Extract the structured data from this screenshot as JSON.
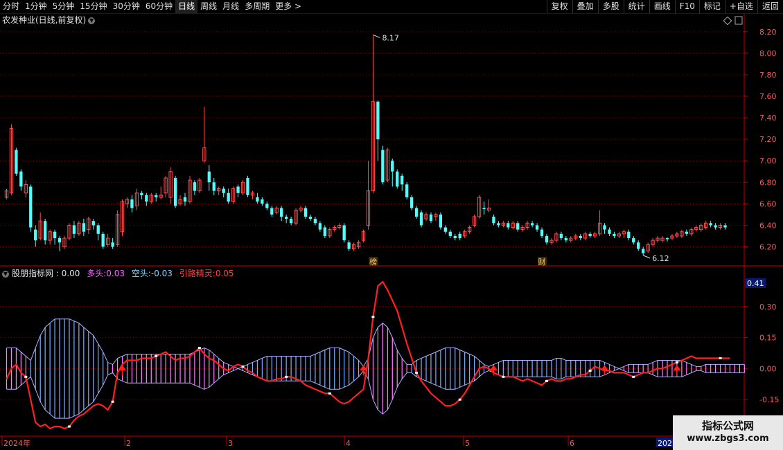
{
  "toolbar": {
    "periods": [
      "分时",
      "1分钟",
      "5分钟",
      "15分钟",
      "30分钟",
      "60分钟",
      "日线",
      "周线",
      "月线",
      "多周期",
      "更多 >"
    ],
    "active_period": "日线",
    "actions": [
      "复权",
      "叠加",
      "多股",
      "统计",
      "画线",
      "F10",
      "标记",
      "+自选",
      "返回"
    ]
  },
  "main_panel": {
    "title": "农发种业(日线,前复权)",
    "high_label": "8.17",
    "low_label": "6.12",
    "y_ticks": [
      "8.20",
      "8.00",
      "7.80",
      "7.60",
      "7.40",
      "7.20",
      "7.00",
      "6.80",
      "6.60",
      "6.40",
      "6.20"
    ],
    "markers": [
      "榜",
      "财"
    ]
  },
  "indicator_panel": {
    "name": "股朋指标网 : 0.00",
    "bull_label": "多头:",
    "bull_value": "0.03",
    "bear_label": "空头:",
    "bear_value": "-0.03",
    "guide_label": "引路精灵:",
    "guide_value": "0.05",
    "current_badge": "0.41",
    "y_ticks": [
      "0.30",
      "0.15",
      "0.00",
      "-0.15"
    ]
  },
  "x_axis": {
    "labels": [
      "2024年",
      "2",
      "3",
      "4",
      "5",
      "6"
    ],
    "current_label": "202"
  },
  "watermark": {
    "line1": "指标公式网",
    "line2": "www.zbgs3.com"
  },
  "colors": {
    "up": "#ff4b4b",
    "down": "#54fcfc",
    "bull_fill": "#ff80ff",
    "bear_fill": "#7fb0ff",
    "guide_line": "#ff2020",
    "grid": "#8b0000",
    "axis": "#c00000"
  },
  "chart_data": {
    "type": "candlestick",
    "title": "农发种业(日线,前复权)",
    "ylim": [
      6.1,
      8.25
    ],
    "highest": 8.17,
    "lowest": 6.12,
    "candles": [
      [
        6.66,
        6.72,
        6.64,
        6.74
      ],
      [
        6.7,
        7.3,
        6.68,
        7.34
      ],
      [
        7.1,
        6.88,
        6.86,
        7.12
      ],
      [
        6.9,
        6.76,
        6.72,
        6.92
      ],
      [
        6.7,
        6.78,
        6.66,
        6.82
      ],
      [
        6.76,
        6.38,
        6.34,
        6.78
      ],
      [
        6.36,
        6.26,
        6.2,
        6.4
      ],
      [
        6.28,
        6.44,
        6.26,
        6.52
      ],
      [
        6.44,
        6.26,
        6.22,
        6.46
      ],
      [
        6.26,
        6.34,
        6.22,
        6.36
      ],
      [
        6.34,
        6.28,
        6.22,
        6.36
      ],
      [
        6.28,
        6.24,
        6.16,
        6.3
      ],
      [
        6.2,
        6.28,
        6.18,
        6.3
      ],
      [
        6.28,
        6.4,
        6.26,
        6.42
      ],
      [
        6.4,
        6.32,
        6.28,
        6.44
      ],
      [
        6.32,
        6.42,
        6.3,
        6.44
      ],
      [
        6.42,
        6.34,
        6.3,
        6.46
      ],
      [
        6.36,
        6.46,
        6.32,
        6.48
      ],
      [
        6.44,
        6.4,
        6.36,
        6.46
      ],
      [
        6.4,
        6.32,
        6.26,
        6.42
      ],
      [
        6.32,
        6.2,
        6.18,
        6.34
      ],
      [
        6.22,
        6.28,
        6.2,
        6.32
      ],
      [
        6.24,
        6.2,
        6.18,
        6.28
      ],
      [
        6.22,
        6.5,
        6.2,
        6.54
      ],
      [
        6.34,
        6.62,
        6.3,
        6.64
      ],
      [
        6.6,
        6.64,
        6.56,
        6.66
      ],
      [
        6.64,
        6.56,
        6.52,
        6.68
      ],
      [
        6.58,
        6.7,
        6.54,
        6.74
      ],
      [
        6.7,
        6.68,
        6.64,
        6.72
      ],
      [
        6.68,
        6.62,
        6.58,
        6.7
      ],
      [
        6.62,
        6.68,
        6.6,
        6.7
      ],
      [
        6.68,
        6.66,
        6.62,
        6.7
      ],
      [
        6.66,
        6.68,
        6.64,
        6.76
      ],
      [
        6.7,
        6.84,
        6.66,
        6.86
      ],
      [
        6.66,
        6.9,
        6.6,
        6.94
      ],
      [
        6.84,
        6.58,
        6.56,
        6.86
      ],
      [
        6.6,
        6.64,
        6.58,
        6.68
      ],
      [
        6.66,
        6.62,
        6.58,
        6.7
      ],
      [
        6.62,
        6.82,
        6.6,
        6.86
      ],
      [
        6.8,
        6.72,
        6.68,
        6.82
      ],
      [
        6.72,
        6.82,
        6.7,
        6.84
      ],
      [
        7.0,
        7.12,
        6.98,
        7.5
      ],
      [
        6.9,
        6.8,
        6.72,
        6.96
      ],
      [
        6.8,
        6.72,
        6.68,
        6.84
      ],
      [
        6.72,
        6.74,
        6.68,
        6.76
      ],
      [
        6.74,
        6.7,
        6.66,
        6.76
      ],
      [
        6.7,
        6.62,
        6.6,
        6.74
      ],
      [
        6.62,
        6.74,
        6.6,
        6.76
      ],
      [
        6.76,
        6.7,
        6.66,
        6.78
      ],
      [
        6.7,
        6.8,
        6.68,
        6.82
      ],
      [
        6.84,
        6.68,
        6.66,
        6.86
      ],
      [
        6.68,
        6.7,
        6.64,
        6.72
      ],
      [
        6.66,
        6.62,
        6.6,
        6.7
      ],
      [
        6.64,
        6.6,
        6.58,
        6.66
      ],
      [
        6.6,
        6.56,
        6.54,
        6.62
      ],
      [
        6.56,
        6.5,
        6.48,
        6.58
      ],
      [
        6.52,
        6.56,
        6.5,
        6.58
      ],
      [
        6.56,
        6.48,
        6.44,
        6.58
      ],
      [
        6.48,
        6.46,
        6.42,
        6.5
      ],
      [
        6.46,
        6.42,
        6.4,
        6.48
      ],
      [
        6.42,
        6.54,
        6.4,
        6.56
      ],
      [
        6.54,
        6.56,
        6.52,
        6.58
      ],
      [
        6.56,
        6.48,
        6.46,
        6.58
      ],
      [
        6.48,
        6.46,
        6.44,
        6.5
      ],
      [
        6.46,
        6.42,
        6.4,
        6.48
      ],
      [
        6.42,
        6.36,
        6.34,
        6.44
      ],
      [
        6.38,
        6.3,
        6.28,
        6.4
      ],
      [
        6.3,
        6.36,
        6.28,
        6.38
      ],
      [
        6.36,
        6.38,
        6.34,
        6.4
      ],
      [
        6.38,
        6.4,
        6.36,
        6.42
      ],
      [
        6.4,
        6.26,
        6.24,
        6.42
      ],
      [
        6.24,
        6.18,
        6.16,
        6.26
      ],
      [
        6.18,
        6.22,
        6.16,
        6.24
      ],
      [
        6.2,
        6.24,
        6.18,
        6.26
      ],
      [
        6.26,
        6.34,
        6.24,
        6.36
      ],
      [
        6.4,
        6.72,
        6.36,
        7.0
      ],
      [
        6.72,
        7.55,
        6.7,
        8.17
      ],
      [
        7.55,
        7.2,
        7.0,
        7.56
      ],
      [
        7.1,
        6.8,
        6.78,
        7.14
      ],
      [
        6.82,
        7.1,
        6.8,
        7.12
      ],
      [
        7.0,
        6.9,
        6.76,
        7.02
      ],
      [
        6.9,
        6.76,
        6.74,
        6.92
      ],
      [
        6.86,
        6.78,
        6.72,
        6.88
      ],
      [
        6.78,
        6.66,
        6.64,
        6.8
      ],
      [
        6.66,
        6.56,
        6.54,
        6.68
      ],
      [
        6.56,
        6.48,
        6.46,
        6.58
      ],
      [
        6.52,
        6.4,
        6.38,
        6.54
      ],
      [
        6.46,
        6.5,
        6.44,
        6.52
      ],
      [
        6.5,
        6.44,
        6.42,
        6.52
      ],
      [
        6.48,
        6.5,
        6.44,
        6.52
      ],
      [
        6.5,
        6.38,
        6.36,
        6.52
      ],
      [
        6.38,
        6.34,
        6.32,
        6.4
      ],
      [
        6.34,
        6.3,
        6.28,
        6.36
      ],
      [
        6.3,
        6.28,
        6.26,
        6.32
      ],
      [
        6.32,
        6.28,
        6.26,
        6.34
      ],
      [
        6.3,
        6.34,
        6.28,
        6.36
      ],
      [
        6.34,
        6.38,
        6.32,
        6.4
      ],
      [
        6.4,
        6.48,
        6.38,
        6.5
      ],
      [
        6.48,
        6.66,
        6.46,
        6.68
      ],
      [
        6.56,
        6.55,
        6.5,
        6.62
      ],
      [
        6.54,
        6.56,
        6.52,
        6.64
      ],
      [
        6.48,
        6.42,
        6.4,
        6.5
      ],
      [
        6.42,
        6.4,
        6.38,
        6.44
      ],
      [
        6.4,
        6.42,
        6.38,
        6.44
      ],
      [
        6.42,
        6.38,
        6.36,
        6.44
      ],
      [
        6.38,
        6.42,
        6.36,
        6.44
      ],
      [
        6.42,
        6.36,
        6.34,
        6.44
      ],
      [
        6.36,
        6.38,
        6.34,
        6.4
      ],
      [
        6.38,
        6.42,
        6.36,
        6.44
      ],
      [
        6.42,
        6.4,
        6.38,
        6.44
      ],
      [
        6.4,
        6.36,
        6.34,
        6.42
      ],
      [
        6.36,
        6.3,
        6.28,
        6.38
      ],
      [
        6.3,
        6.24,
        6.22,
        6.32
      ],
      [
        6.24,
        6.26,
        6.22,
        6.28
      ],
      [
        6.26,
        6.32,
        6.24,
        6.34
      ],
      [
        6.32,
        6.28,
        6.26,
        6.34
      ],
      [
        6.28,
        6.26,
        6.24,
        6.3
      ],
      [
        6.26,
        6.28,
        6.24,
        6.3
      ],
      [
        6.28,
        6.3,
        6.26,
        6.32
      ],
      [
        6.3,
        6.28,
        6.26,
        6.32
      ],
      [
        6.28,
        6.32,
        6.26,
        6.34
      ],
      [
        6.32,
        6.3,
        6.28,
        6.34
      ],
      [
        6.3,
        6.32,
        6.28,
        6.34
      ],
      [
        6.32,
        6.42,
        6.3,
        6.54
      ],
      [
        6.4,
        6.36,
        6.32,
        6.42
      ],
      [
        6.36,
        6.32,
        6.3,
        6.38
      ],
      [
        6.32,
        6.3,
        6.28,
        6.34
      ],
      [
        6.3,
        6.32,
        6.28,
        6.34
      ],
      [
        6.32,
        6.34,
        6.28,
        6.36
      ],
      [
        6.34,
        6.28,
        6.26,
        6.36
      ],
      [
        6.28,
        6.24,
        6.22,
        6.3
      ],
      [
        6.24,
        6.18,
        6.16,
        6.26
      ],
      [
        6.18,
        6.14,
        6.12,
        6.2
      ],
      [
        6.16,
        6.22,
        6.14,
        6.24
      ],
      [
        6.22,
        6.26,
        6.2,
        6.28
      ],
      [
        6.26,
        6.28,
        6.24,
        6.3
      ],
      [
        6.26,
        6.28,
        6.24,
        6.3
      ],
      [
        6.28,
        6.27,
        6.25,
        6.29
      ],
      [
        6.28,
        6.3,
        6.26,
        6.32
      ],
      [
        6.3,
        6.32,
        6.28,
        6.34
      ],
      [
        6.3,
        6.34,
        6.28,
        6.36
      ],
      [
        6.34,
        6.32,
        6.3,
        6.36
      ],
      [
        6.32,
        6.36,
        6.3,
        6.38
      ],
      [
        6.36,
        6.38,
        6.34,
        6.4
      ],
      [
        6.36,
        6.4,
        6.34,
        6.42
      ],
      [
        6.38,
        6.42,
        6.36,
        6.44
      ],
      [
        6.42,
        6.4,
        6.38,
        6.44
      ],
      [
        6.4,
        6.38,
        6.36,
        6.42
      ],
      [
        6.38,
        6.4,
        6.36,
        6.42
      ],
      [
        6.4,
        6.38,
        6.36,
        6.42
      ]
    ],
    "indicator": {
      "ylim": [
        -0.3,
        0.45
      ],
      "bull_bear_envelope": [
        0.1,
        0.1,
        0.1,
        0.08,
        0.06,
        -0.04,
        -0.1,
        -0.16,
        -0.2,
        -0.22,
        -0.24,
        -0.24,
        -0.24,
        -0.24,
        -0.23,
        -0.22,
        -0.2,
        -0.18,
        -0.16,
        -0.12,
        -0.08,
        -0.03,
        0.02,
        0.05,
        0.06,
        0.07,
        0.07,
        0.07,
        0.07,
        0.07,
        0.07,
        0.07,
        0.07,
        0.07,
        0.07,
        0.07,
        0.07,
        0.07,
        0.07,
        0.08,
        0.09,
        0.1,
        0.09,
        0.07,
        0.05,
        0.03,
        0.02,
        0.01,
        0.0,
        -0.01,
        -0.02,
        -0.03,
        -0.04,
        -0.05,
        -0.06,
        -0.06,
        -0.06,
        -0.06,
        -0.06,
        -0.06,
        -0.06,
        -0.06,
        -0.06,
        -0.06,
        -0.07,
        -0.08,
        -0.09,
        -0.1,
        -0.1,
        -0.1,
        -0.09,
        -0.08,
        -0.06,
        -0.04,
        -0.01,
        0.05,
        0.15,
        0.2,
        0.22,
        0.2,
        0.15,
        0.09,
        0.05,
        0.02,
        -0.02,
        -0.04,
        -0.05,
        -0.06,
        -0.07,
        -0.08,
        -0.09,
        -0.1,
        -0.1,
        -0.1,
        -0.09,
        -0.08,
        -0.07,
        -0.06,
        -0.04,
        -0.02,
        -0.01,
        -0.02,
        -0.03,
        -0.04,
        -0.04,
        -0.04,
        -0.04,
        -0.04,
        -0.04,
        -0.04,
        -0.04,
        -0.04,
        -0.04,
        -0.04,
        -0.05,
        -0.05,
        -0.04,
        -0.04,
        -0.04,
        -0.04,
        -0.04,
        -0.04,
        -0.04,
        -0.04,
        -0.03,
        -0.02,
        -0.01,
        0.0,
        0.01,
        0.02,
        0.02,
        0.02,
        0.02,
        0.02,
        0.03,
        0.04,
        0.04,
        0.04,
        0.04,
        0.04,
        0.04,
        0.03,
        0.02,
        0.01,
        0.01,
        0.02,
        0.02,
        0.02,
        0.02,
        0.02,
        0.02,
        0.02,
        0.02,
        0.02
      ],
      "guide_line": [
        -0.05,
        0.0,
        0.02,
        -0.02,
        -0.04,
        -0.15,
        -0.26,
        -0.28,
        -0.27,
        -0.29,
        -0.28,
        -0.28,
        -0.29,
        -0.28,
        -0.25,
        -0.23,
        -0.22,
        -0.2,
        -0.18,
        -0.17,
        -0.18,
        -0.2,
        -0.16,
        -0.02,
        0.02,
        0.04,
        0.04,
        0.04,
        0.05,
        0.05,
        0.05,
        0.06,
        0.07,
        0.08,
        0.06,
        0.04,
        0.05,
        0.05,
        0.06,
        0.08,
        0.1,
        0.07,
        0.05,
        0.04,
        0.02,
        0.0,
        -0.01,
        0.01,
        0.02,
        0.01,
        -0.01,
        -0.02,
        -0.04,
        -0.05,
        -0.06,
        -0.06,
        -0.05,
        -0.05,
        -0.04,
        -0.04,
        -0.05,
        -0.06,
        -0.08,
        -0.09,
        -0.1,
        -0.11,
        -0.12,
        -0.12,
        -0.14,
        -0.16,
        -0.17,
        -0.16,
        -0.14,
        -0.12,
        -0.1,
        0.05,
        0.25,
        0.4,
        0.42,
        0.38,
        0.33,
        0.28,
        0.2,
        0.12,
        0.05,
        -0.02,
        -0.06,
        -0.09,
        -0.12,
        -0.14,
        -0.16,
        -0.18,
        -0.18,
        -0.17,
        -0.15,
        -0.12,
        -0.08,
        -0.04,
        0.0,
        0.01,
        0.0,
        -0.02,
        -0.03,
        -0.04,
        -0.04,
        -0.04,
        -0.05,
        -0.06,
        -0.05,
        -0.06,
        -0.07,
        -0.08,
        -0.06,
        -0.05,
        -0.06,
        -0.06,
        -0.05,
        -0.05,
        -0.04,
        -0.03,
        -0.03,
        -0.01,
        0.01,
        0.0,
        -0.01,
        -0.01,
        -0.02,
        -0.02,
        -0.02,
        -0.03,
        -0.04,
        -0.03,
        -0.02,
        -0.02,
        -0.01,
        0.0,
        0.0,
        0.01,
        0.02,
        0.03,
        0.04,
        0.05,
        0.06,
        0.05,
        0.05,
        0.05,
        0.05,
        0.05,
        0.05,
        0.05,
        0.05
      ]
    }
  }
}
